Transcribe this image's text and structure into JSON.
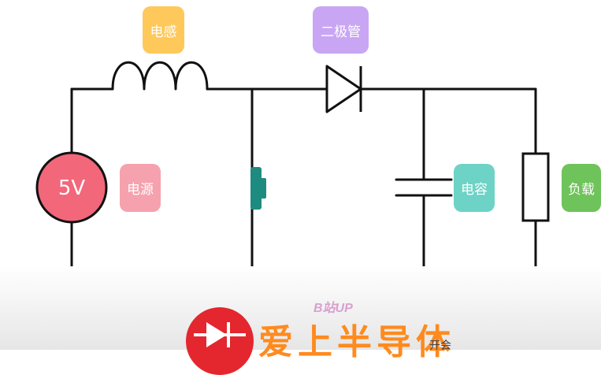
{
  "labels": {
    "inductor": "电感",
    "diode": "二极管",
    "source": "电源",
    "capacitor": "电容",
    "load": "负载",
    "voltage": "5V"
  },
  "colors": {
    "inductor_tag": "#ffc85a",
    "diode_tag": "#c9a6f3",
    "source_tag": "#f5a2ae",
    "capacitor_tag": "#6dd3c6",
    "load_tag": "#6fc35b",
    "source_circle": "#f2677a",
    "switch": "#1e8b80",
    "wire": "#111111"
  },
  "watermark": {
    "platform": "B站UP",
    "brand": "爱上半导体",
    "suffix": "开会"
  }
}
